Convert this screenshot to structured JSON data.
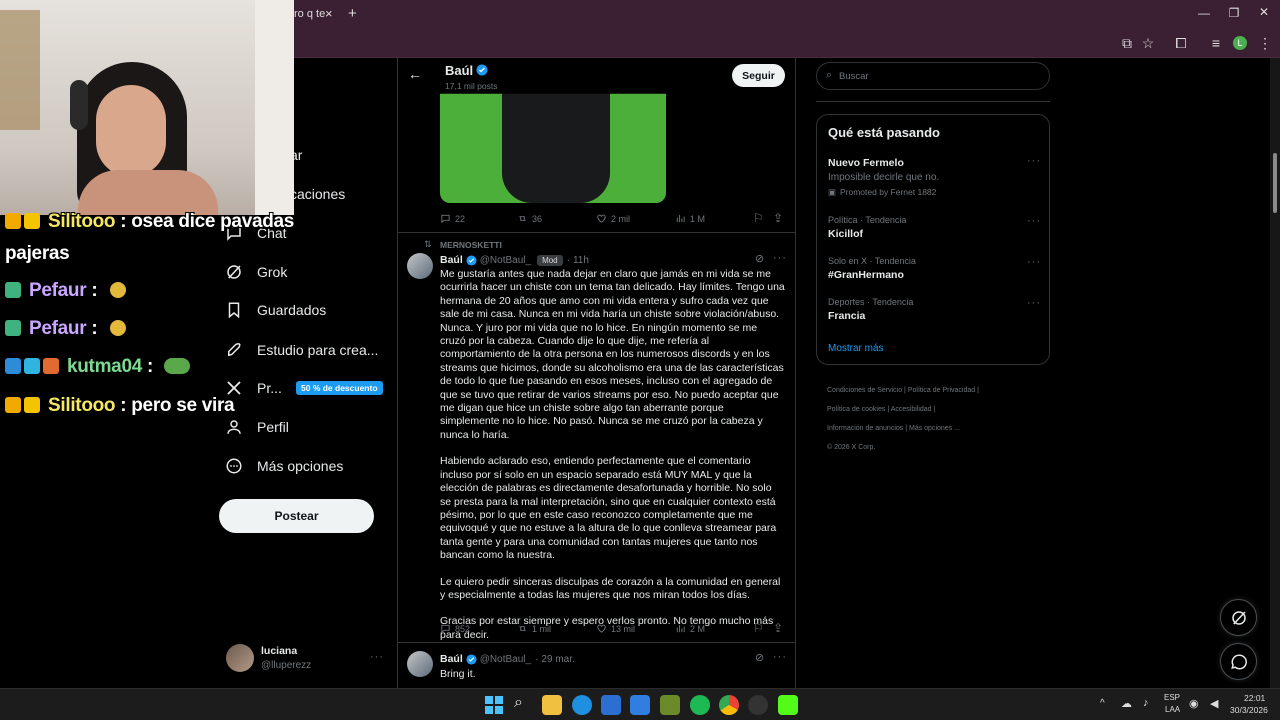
{
  "browser": {
    "tab_title": "ro q te",
    "tab_close": "×",
    "new_tab": "+",
    "profile_initial": "L"
  },
  "nav": {
    "items": [
      {
        "label": "ar"
      },
      {
        "label": "caciones"
      },
      {
        "label": "Chat"
      },
      {
        "label": "Grok"
      },
      {
        "label": "Guardados"
      },
      {
        "label": "Estudio para crea..."
      },
      {
        "label": "Pr..."
      },
      {
        "label": "Perfil"
      },
      {
        "label": "Más opciones"
      }
    ],
    "premium_badge": "50 % de descuento",
    "post_button": "Postear",
    "account_name": "luciana",
    "account_handle": "@lluperezz",
    "account_more": "···"
  },
  "header": {
    "name": "Baúl",
    "posts": "17,1 mil posts",
    "follow_button": "Seguir"
  },
  "tweet1_actions": {
    "replies": "22",
    "retweets": "36",
    "likes": "2 mil",
    "views": "1 M"
  },
  "tweet2": {
    "reposted_by": "MERNOSKETTI",
    "name": "Baúl",
    "handle": "@NotBaul_",
    "mod_badge": "Mod",
    "time": "11h",
    "paragraphs": [
      "Me gustaría antes que nada dejar en claro que jamás en mi vida se me ocurrirla hacer un chiste con un tema tan delicado. Hay límites. Tengo una hermana de 20 años que amo con mi vida entera y sufro cada vez que sale de mi casa. Nunca en mi vida haría un chiste sobre violación/abuso. Nunca. Y juro por mi vida que no lo hice. En ningún momento se me cruzó por la cabeza. Cuando dije lo que dije, me refería al comportamiento de la otra persona en los numerosos discords y en los streams que hicimos, donde su alcoholismo era una de las características de todo lo que fue pasando en esos meses, incluso con el agregado de que se tuvo que retirar de varios streams por eso. No puedo aceptar que me digan que hice un chiste sobre algo tan aberrante porque simplemente no lo hice. No pasó. Nunca se me cruzó por la cabeza y nunca lo haría.",
      "Habiendo aclarado eso, entiendo perfectamente que el comentario incluso por sí solo en un espacio separado está MUY MAL y que la elección de palabras es directamente desafortunada y horrible. No solo se presta para la mal interpretación, sino que en cualquier contexto está pésimo, por lo que en este caso reconozco completamente que me equivoqué y que no estuve a la altura de lo que conlleva streamear para tanta gente y para una comunidad con tantas mujeres que tanto nos bancan como la nuestra.",
      "Le quiero pedir sinceras disculpas de corazón a la comunidad en general y especialmente a todas las mujeres que nos miran todos los días.",
      "Gracias por estar siempre y espero verlos pronto. No tengo mucho más para decir."
    ],
    "replies": "852",
    "retweets": "1 mil",
    "likes": "13 mil",
    "views": "2 M"
  },
  "tweet3": {
    "name": "Baúl",
    "handle": "@NotBaul_",
    "time": "29 mar.",
    "text": "Bring it."
  },
  "sidebar": {
    "search_placeholder": "Buscar",
    "trends_title": "Qué está pasando",
    "promo": {
      "title": "Nuevo Fermelo",
      "subtitle": "Imposible decirle que no.",
      "promoted": "Promoted by Fernet 1882"
    },
    "trends": [
      {
        "context": "Política · Tendencia",
        "name": "Kicillof"
      },
      {
        "context": "Solo en X · Tendencia",
        "name": "#GranHermano"
      },
      {
        "context": "Deportes · Tendencia",
        "name": "Francia"
      }
    ],
    "show_more": "Mostrar más",
    "footer": {
      "l1": "Condiciones de Servicio",
      "l2": "Política de Privacidad",
      "l3": "Política de cookies",
      "l4": "Accesibilidad",
      "l5": "Información de anuncios",
      "l6": "Más opciones ...",
      "copyright": "© 2026 X Corp."
    }
  },
  "chat": [
    {
      "user": "Silitooo",
      "text": ": osea dice pavadas"
    },
    {
      "user": "",
      "text": "pajeras"
    },
    {
      "user": "Pefaur",
      "text": ":"
    },
    {
      "user": "Pefaur",
      "text": ":"
    },
    {
      "user": "kutma04",
      "text": ":"
    },
    {
      "user": "Silitooo",
      "text": ": pero se vira"
    }
  ],
  "taskbar": {
    "lang1": "ESP",
    "lang2": "LAA",
    "time": "22:01",
    "date": "30/3/2026"
  },
  "colors": {
    "accent": "#1d9bf0",
    "browser_frame": "#3b1f33",
    "chat_user_yellow": "#f5e663",
    "chat_user_purple": "#c9a6ff",
    "chat_user_green": "#7cd992"
  }
}
